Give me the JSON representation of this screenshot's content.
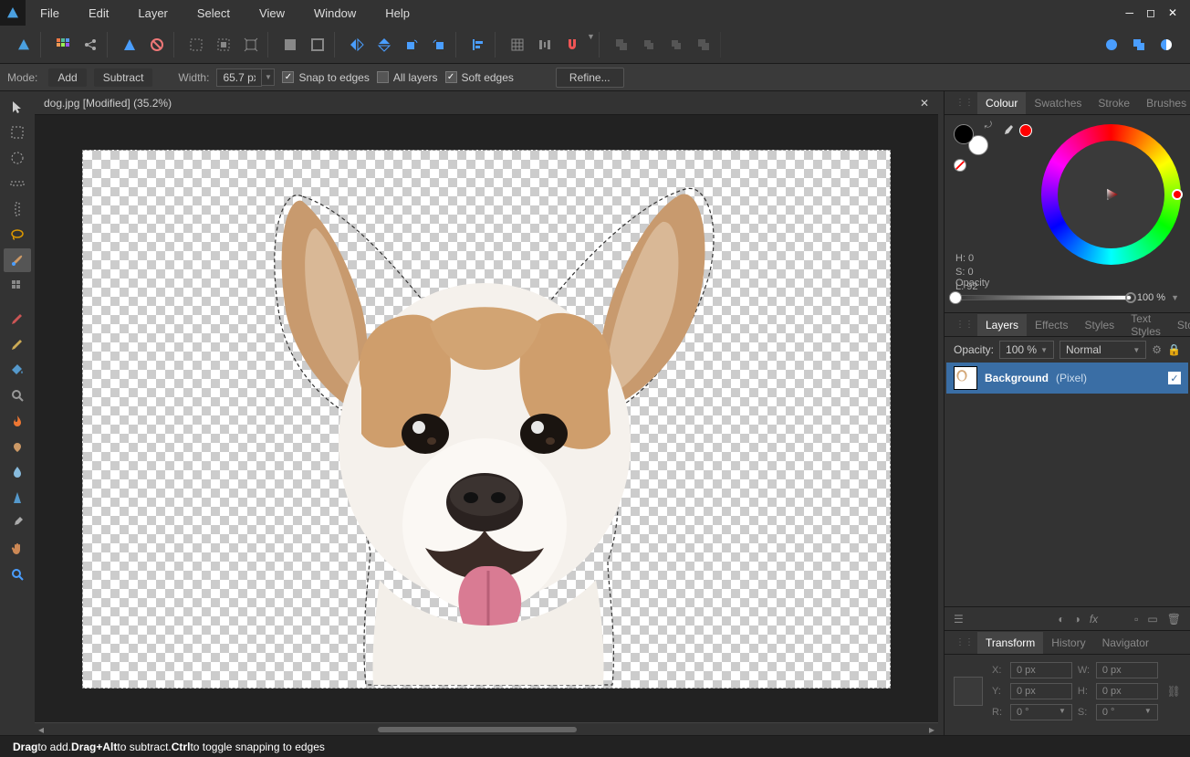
{
  "menubar": [
    "File",
    "Edit",
    "Layer",
    "Select",
    "View",
    "Window",
    "Help"
  ],
  "context": {
    "mode_label": "Mode:",
    "add": "Add",
    "subtract": "Subtract",
    "width_label": "Width:",
    "width_value": "65.7 px",
    "snap": "Snap to edges",
    "all_layers": "All layers",
    "soft_edges": "Soft edges",
    "refine": "Refine..."
  },
  "doc_tab": "dog.jpg [Modified] (35.2%)",
  "panels": {
    "color_tabs": [
      "Colour",
      "Swatches",
      "Stroke",
      "Brushes"
    ],
    "hsl": [
      "H: 0",
      "S: 0",
      "L: 92"
    ],
    "opacity_label": "Opacity",
    "opacity_value": "100 %",
    "layer_tabs": [
      "Layers",
      "Effects",
      "Styles",
      "Text Styles",
      "Stock"
    ],
    "layer_opacity_label": "Opacity:",
    "layer_opacity_value": "100 %",
    "layer_blend": "Normal",
    "layer_name": "Background",
    "layer_type": "(Pixel)",
    "transform_tabs": [
      "Transform",
      "History",
      "Navigator"
    ],
    "tf": {
      "x": "0 px",
      "y": "0 px",
      "w": "0 px",
      "h": "0 px",
      "r": "0 °",
      "s": "0 °",
      "xl": "X:",
      "yl": "Y:",
      "wl": "W:",
      "hl": "H:",
      "rl": "R:",
      "sl": "S:"
    }
  },
  "status": {
    "drag": "Drag",
    "t1": " to add. ",
    "dragalt": "Drag+Alt",
    "t2": " to subtract. ",
    "ctrl": "Ctrl",
    "t3": " to toggle snapping to edges"
  }
}
